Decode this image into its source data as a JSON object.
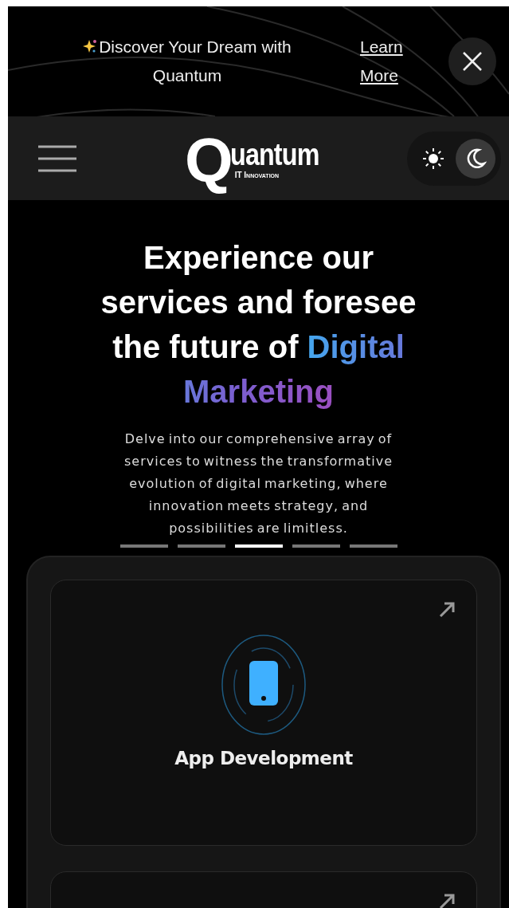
{
  "banner": {
    "text": "Discover Your Dream with Quantum",
    "link": "Learn More"
  },
  "nav": {
    "logo": {
      "letter": "Q",
      "word": "uantum",
      "tagline": "IT Innovation"
    },
    "theme_toggle": [
      {
        "kind": "sun",
        "selected": false
      },
      {
        "kind": "moon",
        "selected": true
      }
    ]
  },
  "hero": {
    "heading": "Experience our services and foresee the future of",
    "heading_highlight": "Digital Marketing",
    "description": "Delve into our comprehensive array of services to witness the transformative evolution of digital marketing, where innovation meets strategy, and possibilities are limitless.",
    "carousel_dots": [
      {
        "selected": false
      },
      {
        "selected": false
      },
      {
        "selected": true
      },
      {
        "selected": false
      },
      {
        "selected": false
      }
    ]
  },
  "services": {
    "cards": [
      {
        "title": "App Development"
      }
    ],
    "next_card_cut_off": true
  }
}
